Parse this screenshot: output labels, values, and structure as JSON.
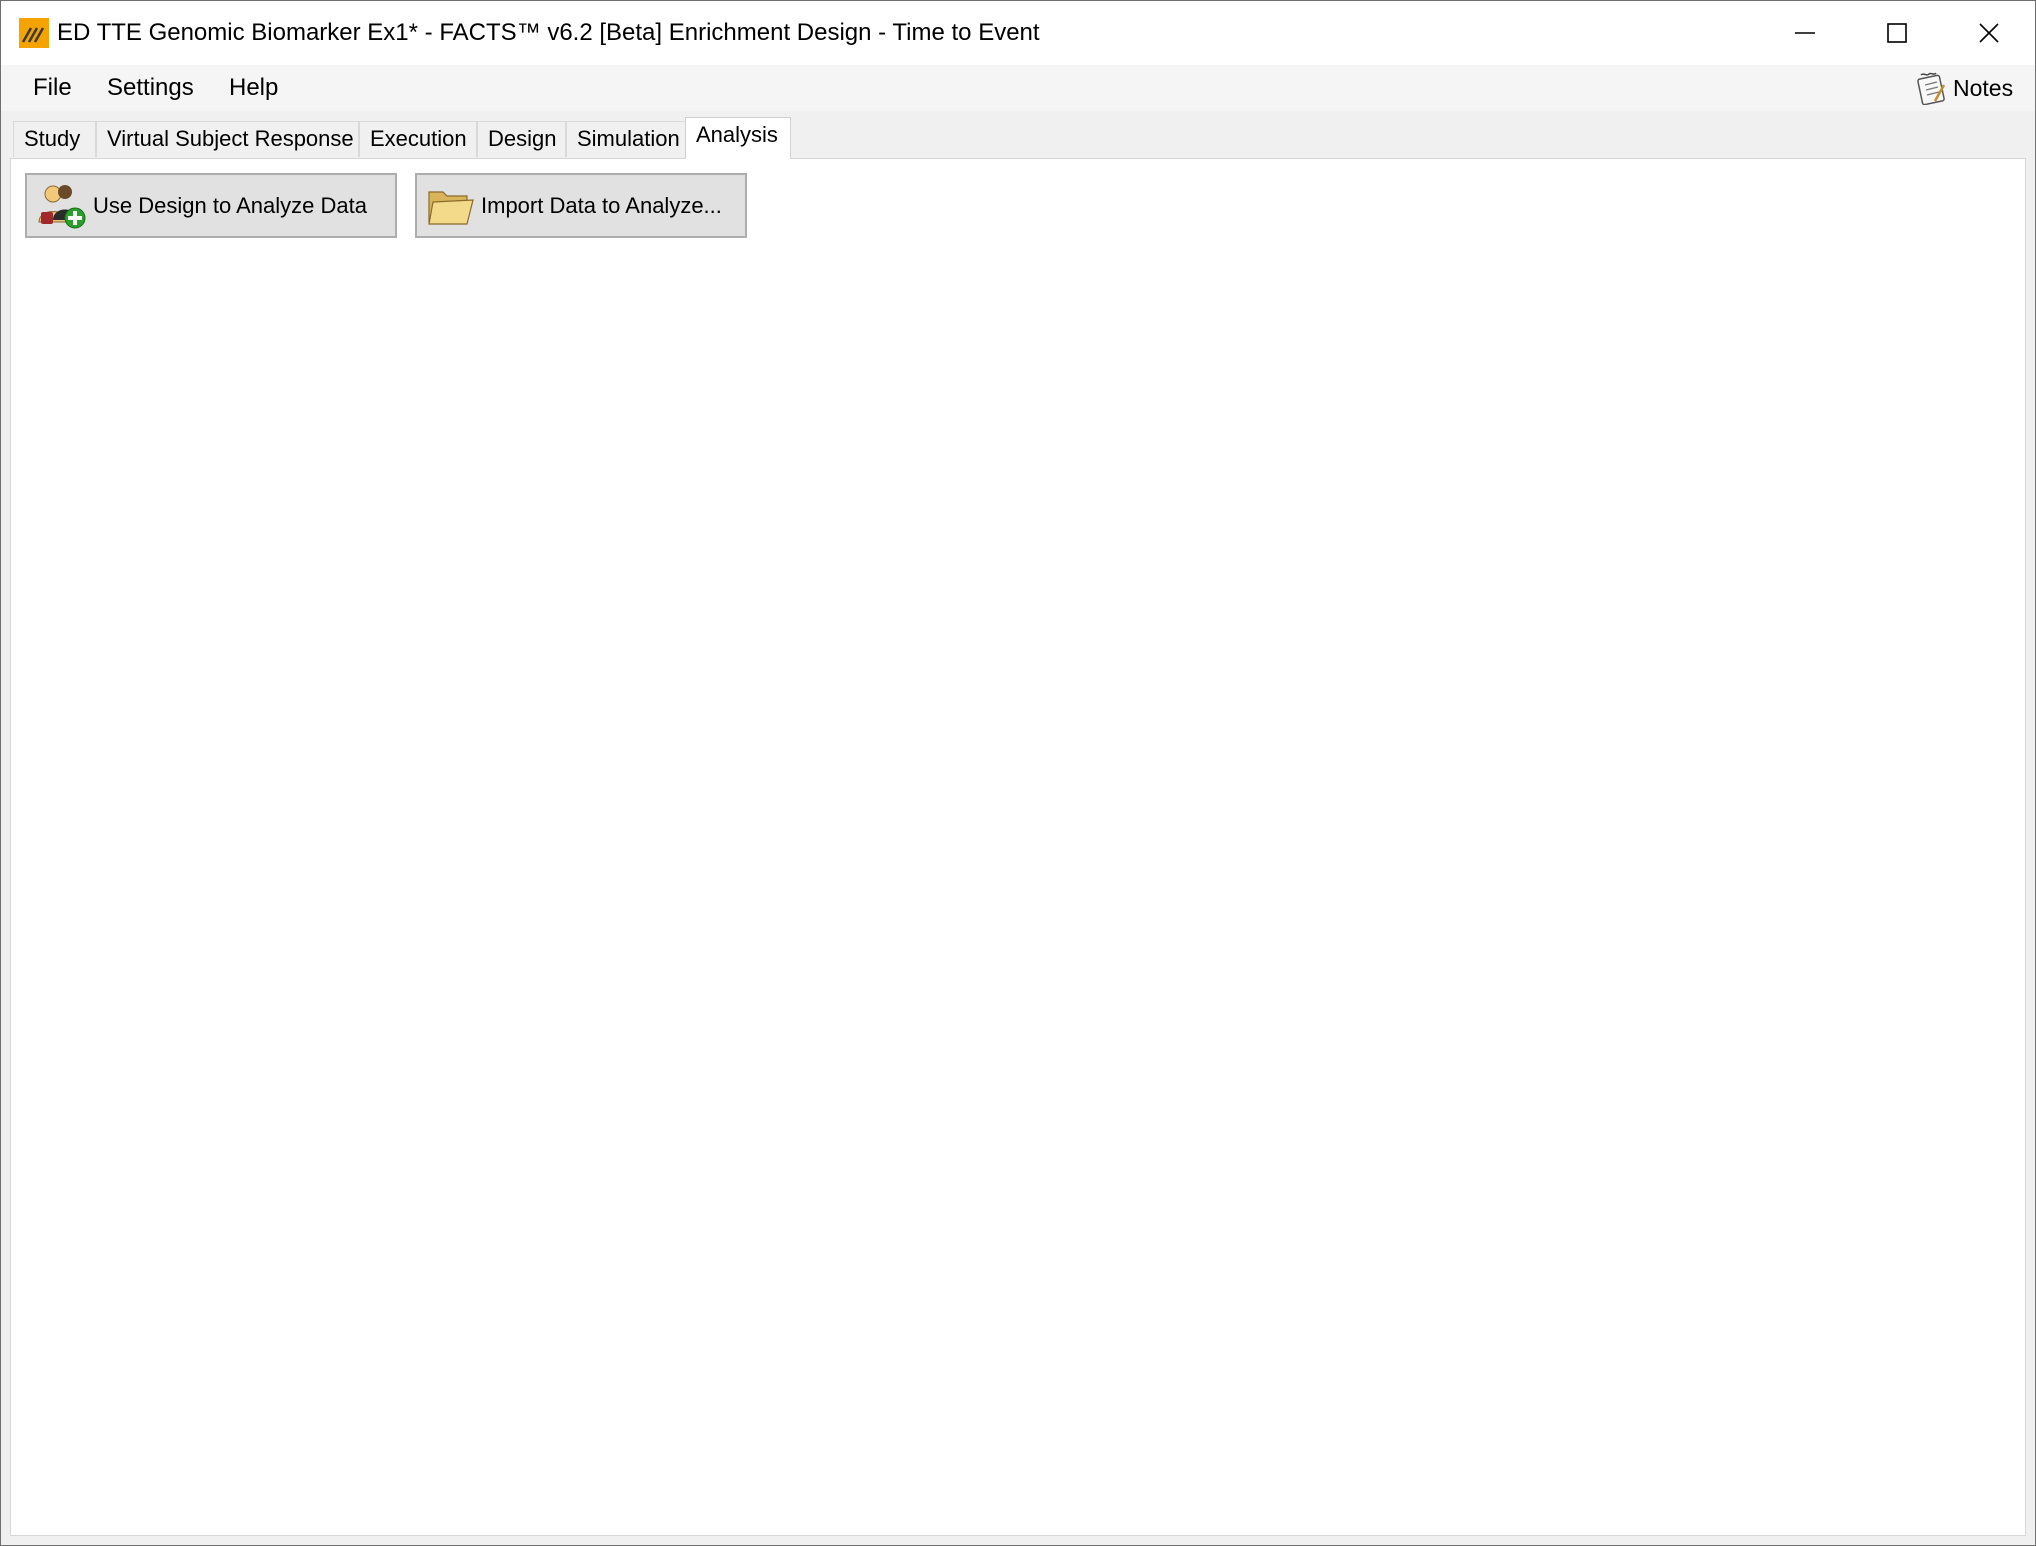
{
  "window": {
    "title": "ED TTE Genomic Biomarker Ex1* - FACTS™ v6.2 [Beta] Enrichment Design - Time to Event",
    "controls": {
      "minimize_icon": "minimize-icon",
      "maximize_icon": "maximize-icon",
      "close_icon": "close-icon"
    }
  },
  "menubar": {
    "items": [
      {
        "label": "File"
      },
      {
        "label": "Settings"
      },
      {
        "label": "Help"
      }
    ],
    "notes_label": "Notes"
  },
  "tabs": [
    {
      "label": "Study",
      "active": false
    },
    {
      "label": "Virtual Subject Response",
      "active": false
    },
    {
      "label": "Execution",
      "active": false
    },
    {
      "label": "Design",
      "active": false
    },
    {
      "label": "Simulation",
      "active": false
    },
    {
      "label": "Analysis",
      "active": true
    }
  ],
  "analysis": {
    "use_design_label": "Use Design to Analyze Data",
    "import_data_label": "Import Data to Analyze..."
  },
  "colors": {
    "accent": "#f5a300",
    "button_bg": "#e1e1e1",
    "button_border": "#adadad",
    "window_border": "#6f6f6f"
  }
}
